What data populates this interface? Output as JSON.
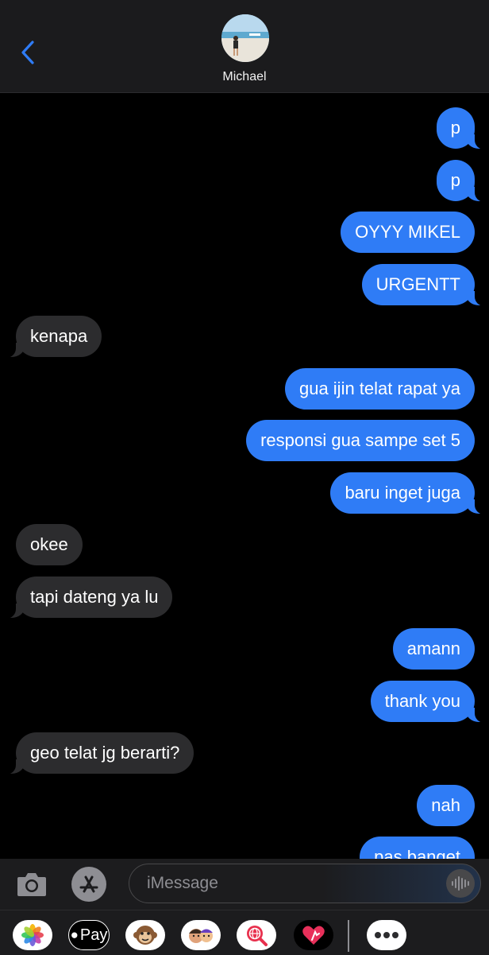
{
  "header": {
    "contact_name": "Michael",
    "back_icon": "chevron-left-icon"
  },
  "messages": [
    {
      "dir": "out",
      "text": "p",
      "tail": true
    },
    {
      "dir": "out",
      "text": "p",
      "tail": true
    },
    {
      "dir": "out",
      "text": "OYYY MIKEL",
      "tail": false
    },
    {
      "dir": "out",
      "text": "URGENTT",
      "tail": true
    },
    {
      "dir": "in",
      "text": "kenapa",
      "tail": true
    },
    {
      "dir": "out",
      "text": "gua ijin telat rapat ya",
      "tail": false
    },
    {
      "dir": "out",
      "text": "responsi gua sampe set 5",
      "tail": false
    },
    {
      "dir": "out",
      "text": "baru inget juga",
      "tail": true
    },
    {
      "dir": "in",
      "text": "okee",
      "tail": false
    },
    {
      "dir": "in",
      "text": "tapi dateng ya lu",
      "tail": true
    },
    {
      "dir": "out",
      "text": "amann",
      "tail": false
    },
    {
      "dir": "out",
      "text": "thank you",
      "tail": true
    },
    {
      "dir": "in",
      "text": "geo telat jg berarti?",
      "tail": true
    },
    {
      "dir": "out",
      "text": "nah",
      "tail": false
    },
    {
      "dir": "out",
      "text": "pas banget",
      "tail": true
    }
  ],
  "input_bar": {
    "placeholder": "iMessage",
    "icons": [
      "camera-icon",
      "app-store-icon",
      "audio-waveform-icon"
    ]
  },
  "app_drawer": {
    "apps": [
      {
        "name": "photos-app-icon"
      },
      {
        "name": "apple-pay-app-icon",
        "label": "Pay"
      },
      {
        "name": "memoji-monkey-app-icon"
      },
      {
        "name": "memoji-stickers-app-icon"
      },
      {
        "name": "web-search-app-icon"
      },
      {
        "name": "digital-touch-app-icon"
      },
      {
        "name": "more-apps-icon"
      }
    ]
  },
  "colors": {
    "outgoing_bubble": "#2f7cf6",
    "incoming_bubble": "#2c2c2e",
    "accent": "#2f7cf6"
  }
}
